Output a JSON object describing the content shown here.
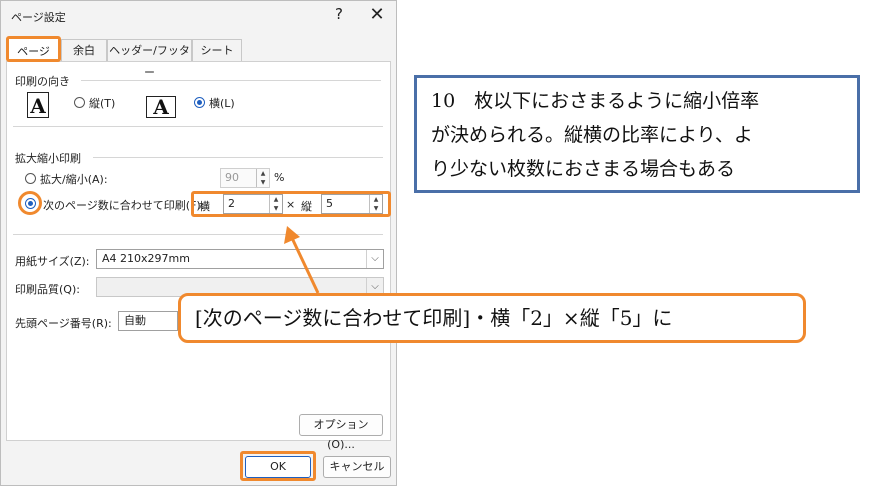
{
  "dialog": {
    "title": "ページ設定",
    "help": "?",
    "close": "✕",
    "tabs": [
      "ページ",
      "余白",
      "ヘッダー/フッター",
      "シート"
    ],
    "orientation": {
      "group_label": "印刷の向き",
      "portrait_icon": "A",
      "portrait_label": "縦(T)",
      "landscape_icon": "A",
      "landscape_label": "横(L)"
    },
    "scaling": {
      "group_label": "拡大縮小印刷",
      "adjust_label": "拡大/縮小(A):",
      "adjust_value": "90",
      "percent": "%",
      "fit_label": "次のページ数に合わせて印刷(F):",
      "wide_label": "横",
      "wide_value": "2",
      "times": "×",
      "tall_label": "縦",
      "tall_value": "5"
    },
    "paper_size_label": "用紙サイズ(Z):",
    "paper_size_value": "A4 210x297mm",
    "print_quality_label": "印刷品質(Q):",
    "print_quality_value": "",
    "first_page_label": "先頭ページ番号(R):",
    "first_page_value": "自動",
    "options_button": "オプション(O)...",
    "ok_button": "OK",
    "cancel_button": "キャンセル"
  },
  "callouts": {
    "info_line1": "10　枚以下におさまるように縮小倍率",
    "info_line2": "が決められる。縦横の比率により、よ",
    "info_line3": "り少ない枚数におさまる場合もある",
    "instruction": "[次のページ数に合わせて印刷]・横「2」×縦「5」に"
  },
  "colors": {
    "highlight": "#f0892e",
    "info_border": "#4a6fa8",
    "radio_selected": "#1f5fbf"
  }
}
